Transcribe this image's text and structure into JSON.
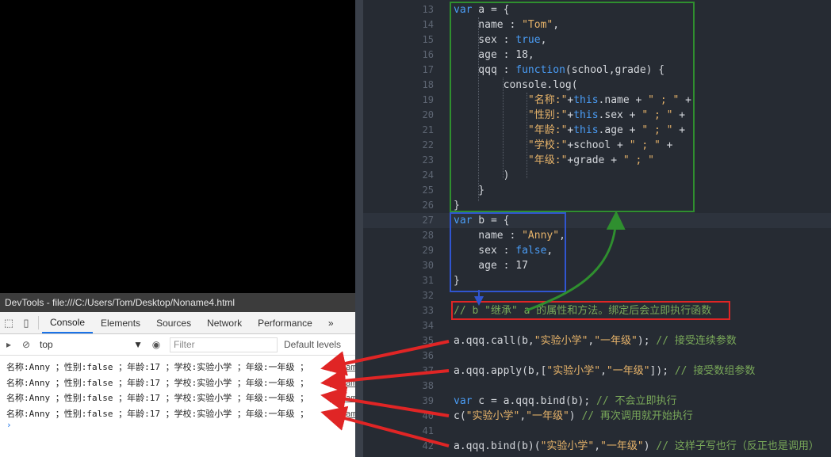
{
  "devtools": {
    "title": "DevTools - file:///C:/Users/Tom/Desktop/Noname4.html",
    "tabs": [
      "Console",
      "Elements",
      "Sources",
      "Network",
      "Performance"
    ],
    "more_tabs": "»",
    "context": "top",
    "filter_placeholder": "Filter",
    "levels": "Default levels",
    "log_lines": [
      "名称:Anny ；性别:false ；年龄:17 ；学校:实验小学 ；年级:一年级 ；",
      "名称:Anny ；性别:false ；年龄:17 ；学校:实验小学 ；年级:一年级 ；",
      "名称:Anny ；性别:false ；年龄:17 ；学校:实验小学 ；年级:一年级 ；",
      "名称:Anny ；性别:false ；年龄:17 ；学校:实验小学 ；年级:一年级 ；"
    ],
    "log_source": "Nonam",
    "prompt": "›"
  },
  "editor": {
    "lines": [
      {
        "n": "13",
        "t": "var a = {"
      },
      {
        "n": "14",
        "t": "    name : \"Tom\","
      },
      {
        "n": "15",
        "t": "    sex : true,"
      },
      {
        "n": "16",
        "t": "    age : 18,"
      },
      {
        "n": "17",
        "t": "    qqq : function(school,grade) {"
      },
      {
        "n": "18",
        "t": "        console.log("
      },
      {
        "n": "19",
        "t": "            \"名称:\"+this.name + \" ; \" +"
      },
      {
        "n": "20",
        "t": "            \"性别:\"+this.sex + \" ; \" +"
      },
      {
        "n": "21",
        "t": "            \"年龄:\"+this.age + \" ; \" +"
      },
      {
        "n": "22",
        "t": "            \"学校:\"+school + \" ; \" +"
      },
      {
        "n": "23",
        "t": "            \"年级:\"+grade + \" ; \""
      },
      {
        "n": "24",
        "t": "        )"
      },
      {
        "n": "25",
        "t": "    }"
      },
      {
        "n": "26",
        "t": "}"
      },
      {
        "n": "27",
        "t": "var b = {"
      },
      {
        "n": "28",
        "t": "    name : \"Anny\","
      },
      {
        "n": "29",
        "t": "    sex : false,"
      },
      {
        "n": "30",
        "t": "    age : 17"
      },
      {
        "n": "31",
        "t": "}"
      },
      {
        "n": "32",
        "t": ""
      },
      {
        "n": "33",
        "t": "// b \"继承\" a 的属性和方法。绑定后会立即执行函数"
      },
      {
        "n": "34",
        "t": ""
      },
      {
        "n": "35",
        "t": "a.qqq.call(b,\"实验小学\",\"一年级\"); // 接受连续参数"
      },
      {
        "n": "36",
        "t": ""
      },
      {
        "n": "37",
        "t": "a.qqq.apply(b,[\"实验小学\",\"一年级\"]); // 接受数组参数"
      },
      {
        "n": "38",
        "t": ""
      },
      {
        "n": "39",
        "t": "var c = a.qqq.bind(b); // 不会立即执行"
      },
      {
        "n": "40",
        "t": "c(\"实验小学\",\"一年级\") // 再次调用就开始执行"
      },
      {
        "n": "41",
        "t": ""
      },
      {
        "n": "42",
        "t": "a.qqq.bind(b)(\"实验小学\",\"一年级\") // 这样子写也行（反正也是调用）"
      }
    ]
  },
  "colors": {
    "editor_bg": "#262b33",
    "keyword": "#4a9df6",
    "string": "#e8b46a",
    "comment": "#79a859",
    "annotation_green": "#2f8f2f",
    "annotation_blue": "#3055d0",
    "annotation_red": "#e02525"
  }
}
